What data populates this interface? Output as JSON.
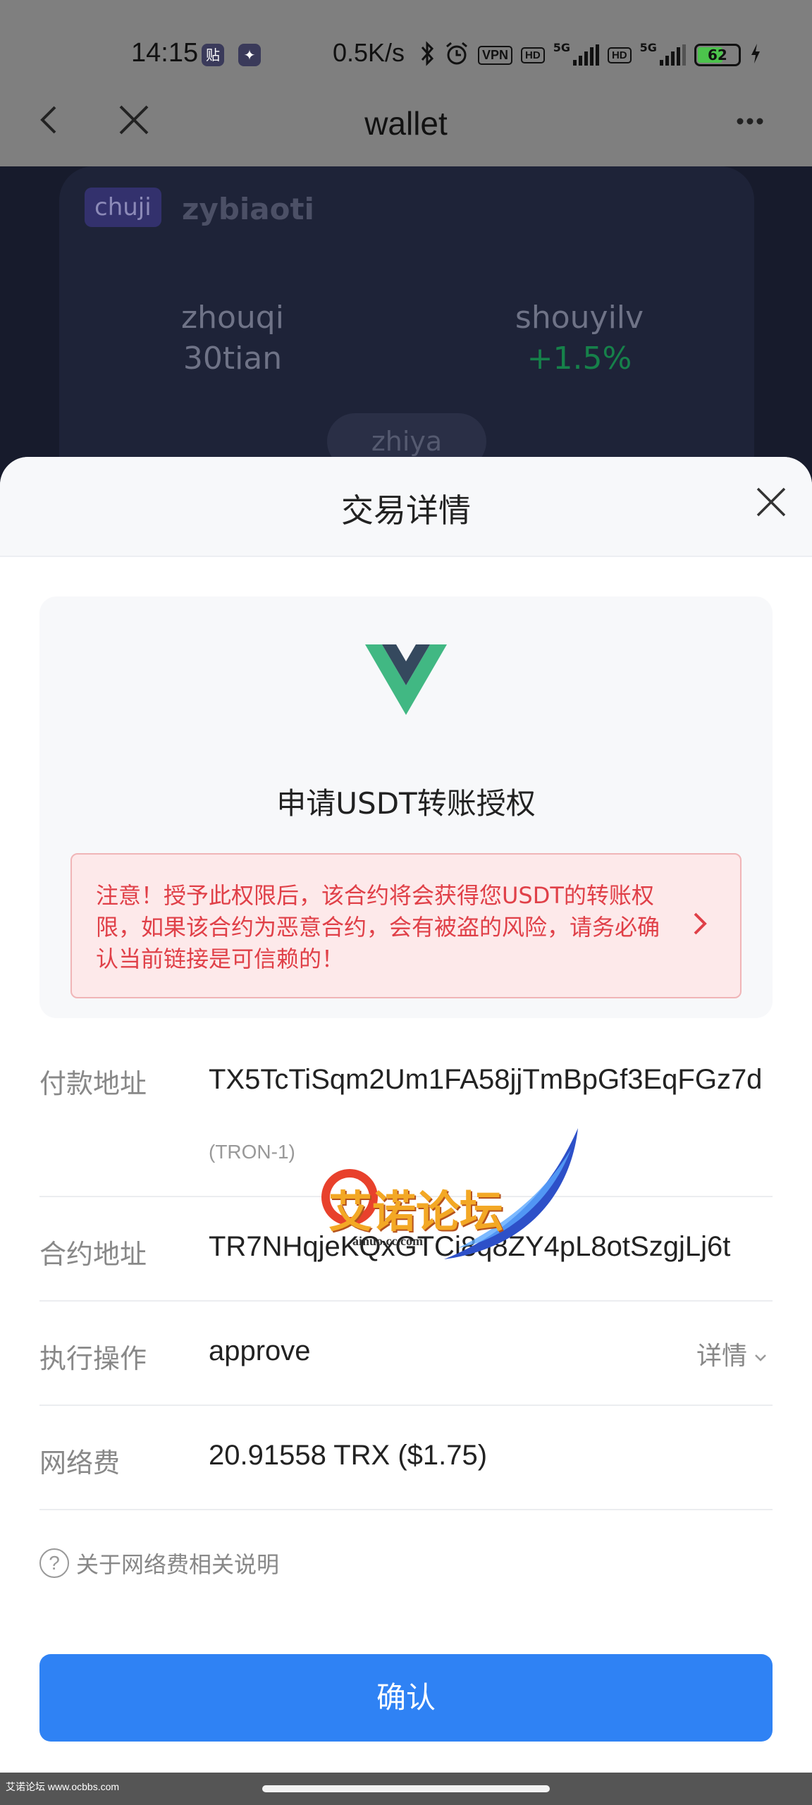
{
  "status_bar": {
    "time": "14:15",
    "app_icon_1": "贴",
    "app_icon_2": "✦",
    "net_speed": "0.5K/s",
    "vpn_label": "VPN",
    "hd1_label": "HD",
    "hd2_label": "HD",
    "sim1_label": "5G",
    "sim2_label": "5G",
    "battery_level": "62",
    "battery_fraction": 0.62
  },
  "nav": {
    "title": "wallet"
  },
  "background_card": {
    "tag": "chuji",
    "name": "zybiaoti",
    "stat1_label": "zhouqi",
    "stat1_value": "30tian",
    "stat2_label": "shouyilv",
    "stat2_value": "+1.5%",
    "pill_label": "zhiya",
    "green_color": "#16814a"
  },
  "sheet": {
    "title": "交易详情",
    "auth_title": "申请USDT转账授权",
    "warning": "注意！授予此权限后，该合约将会获得您USDT的转账权限，如果该合约为恶意合约，会有被盗的风险，请务必确认当前链接是可信赖的！",
    "warning_color": "#e04048",
    "rows": {
      "payer_label": "付款地址",
      "payer_value": "TX5TcTiSqm2Um1FA58jjTmBpGf3EqFGz7d",
      "payer_network": "(TRON-1)",
      "contract_label": "合约地址",
      "contract_value": "TR7NHqjeKQxGTCi8q8ZY4pL8otSzgjLj6t",
      "action_label": "执行操作",
      "action_value": "approve",
      "action_details": "详情",
      "fee_label": "网络费",
      "fee_value": "20.91558 TRX ($1.75)"
    },
    "fee_help_icon": "?",
    "fee_help": "关于网络费相关说明",
    "confirm": "确认",
    "accent_color": "#2f82f4"
  },
  "watermark": {
    "text": "艾诺论坛",
    "url": "ainuo.cc.com"
  },
  "footer": {
    "note": "艾诺论坛 www.ocbbs.com"
  }
}
